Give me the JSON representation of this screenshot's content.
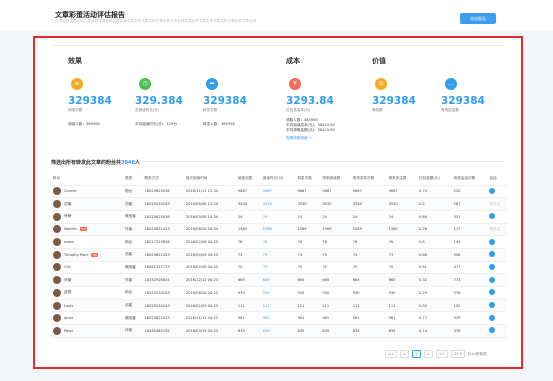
{
  "header": {
    "title": "文章彩蛋活动评估报告",
    "subtitle": "文章名称文章名称文章名称文章名称文章名称文章名称文章名称文章名称文章名称文章名称文章名称文章名称文章名称文章名称",
    "export_label": "导出报告"
  },
  "effect": {
    "title": "效果",
    "stats": [
      {
        "value": "329384",
        "label": "阅读次数",
        "icon": "list-icon",
        "color": "#f7a922"
      },
      {
        "value": "329.384",
        "label": "总阅读时长(分)",
        "icon": "clock-icon",
        "color": "#4cbf55"
      },
      {
        "value": "329384",
        "label": "转发次数",
        "icon": "share-icon",
        "color": "#2f9df2"
      }
    ],
    "notes": [
      "阅读人数：384956",
      "平均阅读时长(分)：129分",
      "转发人数：384956"
    ]
  },
  "cost": {
    "title": "成本",
    "icon": "cost-icon",
    "color": "#f26b5b",
    "value": "3293.84",
    "label": "红包总成本(元)",
    "lines": [
      "领取人数：384956",
      "平均阅读成本(元)：38419.56",
      "平均领取金额(元)：38419.56"
    ],
    "link": "查看领取明细 >"
  },
  "value": {
    "title": "价值",
    "stats": [
      {
        "value": "329384",
        "label": "商机数",
        "icon": "target-icon",
        "color": "#f7a922"
      },
      {
        "value": "329384",
        "label": "有效会话数",
        "icon": "chat-icon",
        "color": "#2f9df2"
      }
    ]
  },
  "filter": {
    "prefix": "筛选出所有转发此文章的粉丝共",
    "count": "3940",
    "suffix": "人"
  },
  "table": {
    "headers": [
      "粉丝",
      "类型",
      "联系方式",
      "首次阅读时间",
      "阅读次数",
      "阅读时长(分)",
      "转发次数",
      "带来阅读数",
      "带来浏览次数",
      "带来关注数",
      "红包金额(元)",
      "有效会话次数",
      "会话"
    ],
    "rows": [
      {
        "name": "Conner",
        "vip": "",
        "type": "粉丝",
        "phone": "18029625036",
        "time": "2016/11/11 12:34",
        "reads": "9867",
        "dur": "9867",
        "fwd": "9867",
        "br": "9867",
        "bv": "9867",
        "bf": "9867",
        "money": "0.74",
        "sess": "220",
        "chat": "dot"
      },
      {
        "name": "洪楠",
        "vip": "",
        "type": "访客",
        "phone": "18029234163",
        "time": "2016/06/08 10:24",
        "reads": "3530",
        "dur": "3530",
        "fwd": "3530",
        "br": "3530",
        "bv": "3530",
        "bf": "3530",
        "money": "0.2",
        "sess": "267",
        "chat": "未关注"
      },
      {
        "name": "乔静",
        "vip": "",
        "type": "微信客",
        "phone": "18029625036",
        "time": "2016/03/08 10:34",
        "reads": "24",
        "dur": "24",
        "fwd": "24",
        "br": "24",
        "bv": "24",
        "bf": "24",
        "money": "0.86",
        "sess": "351",
        "chat": "dot"
      },
      {
        "name": "Warren",
        "vip": "VIP",
        "type": "作者",
        "phone": "18029821423",
        "time": "2016/06/28 05:34",
        "reads": "1589",
        "dur": "1586",
        "fwd": "1589",
        "br": "1589",
        "bv": "1589",
        "bf": "1589",
        "money": "0.26",
        "sess": "117",
        "chat": "未关注"
      },
      {
        "name": "Adam",
        "vip": "",
        "type": "粉丝",
        "phone": "18017519856",
        "time": "2016/02/08 04:23",
        "reads": "76",
        "dur": "76",
        "fwd": "76",
        "br": "76",
        "bv": "76",
        "bf": "76",
        "money": "0.6",
        "sess": "144",
        "chat": "dot"
      },
      {
        "name": "Timothy Mart",
        "vip": "VIP",
        "type": "访客",
        "phone": "18029821423",
        "time": "2016/04/05 04:23",
        "reads": "73",
        "dur": "73",
        "fwd": "73",
        "br": "73",
        "bv": "73",
        "bf": "73",
        "money": "0.68",
        "sess": "506",
        "chat": "dot"
      },
      {
        "name": "Cris",
        "vip": "",
        "type": "微信客",
        "phone": "18082317723",
        "time": "2016/02/08 04:23",
        "reads": "70",
        "dur": "70",
        "fwd": "70",
        "br": "70",
        "bv": "70",
        "bf": "70",
        "money": "0.61",
        "sess": "477",
        "chat": "dot"
      },
      {
        "name": "尹薇",
        "vip": "",
        "type": "作者",
        "phone": "18252926854",
        "time": "2016/12/12 04:23",
        "reads": "665",
        "dur": "665",
        "fwd": "665",
        "br": "665",
        "bv": "665",
        "bf": "665",
        "money": "0.32",
        "sess": "773",
        "chat": "dot"
      },
      {
        "name": "武霞",
        "vip": "",
        "type": "粉丝",
        "phone": "18529234163",
        "time": "2016/06/28 04:23",
        "reads": "930",
        "dur": "930",
        "fwd": "930",
        "br": "930",
        "bv": "930",
        "bf": "930",
        "money": "0.29",
        "sess": "576",
        "chat": "dot"
      },
      {
        "name": "Louis",
        "vip": "",
        "type": "访客",
        "phone": "18529234163",
        "time": "2016/02/05 04:23",
        "reads": "111",
        "dur": "111",
        "fwd": "111",
        "br": "111",
        "bv": "111",
        "bf": "111",
        "money": "0.34",
        "sess": "152",
        "chat": "dot"
      },
      {
        "name": "Janet",
        "vip": "",
        "type": "微信客",
        "phone": "18029821423",
        "time": "2016/11/11 04:23",
        "reads": "961",
        "dur": "961",
        "fwd": "961",
        "br": "961",
        "bv": "961",
        "bf": "961",
        "money": "0.77",
        "sess": "529",
        "chat": "dot"
      },
      {
        "name": "Peter",
        "vip": "",
        "type": "作者",
        "phone": "18430440735",
        "time": "2016/03/15 04:23",
        "reads": "835",
        "dur": "835",
        "fwd": "835",
        "br": "835",
        "bv": "835",
        "bf": "835",
        "money": "0.14",
        "sess": "378",
        "chat": "dot"
      }
    ]
  },
  "pager": {
    "first": "<<",
    "prev": "<",
    "page": "1",
    "next": ">",
    "last": ">>",
    "size": "20 ▾",
    "total": "共40条数据"
  }
}
